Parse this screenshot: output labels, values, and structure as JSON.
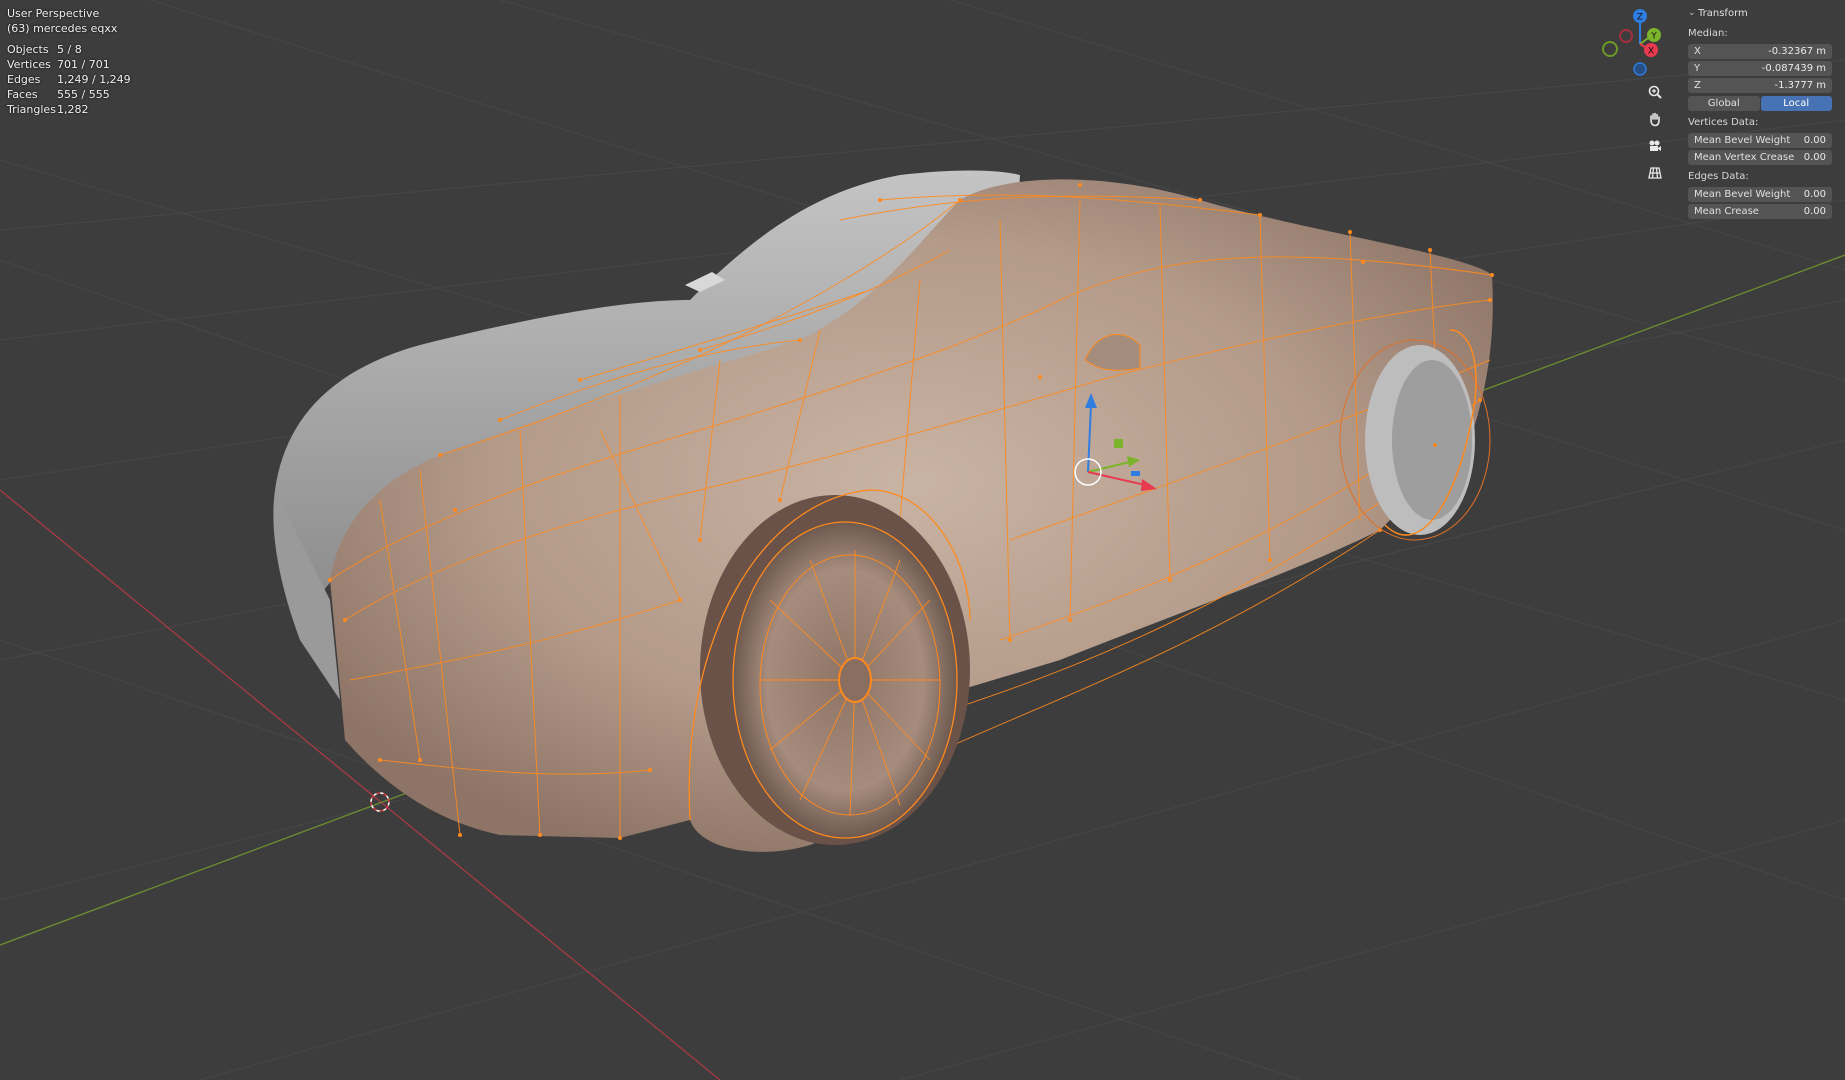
{
  "viewport": {
    "view_name": "User Perspective",
    "object_name": "(63) mercedes eqxx",
    "stats": [
      {
        "label": "Objects",
        "value": "5 / 8"
      },
      {
        "label": "Vertices",
        "value": "701 / 701"
      },
      {
        "label": "Edges",
        "value": "1,249 / 1,249"
      },
      {
        "label": "Faces",
        "value": "555 / 555"
      },
      {
        "label": "Triangles",
        "value": "1,282"
      }
    ]
  },
  "gizmo": {
    "axes": {
      "x": "X",
      "y": "Y",
      "z": "Z"
    },
    "colors": {
      "x": "#e8394f",
      "y": "#7bb32a",
      "z": "#2f7de1",
      "selection": "#ff8a1e"
    }
  },
  "tools": [
    "zoom-icon",
    "hand-pan-icon",
    "camera-icon",
    "grid-view-icon"
  ],
  "transform_panel": {
    "title": "Transform",
    "median_label": "Median:",
    "x": {
      "label": "X",
      "value": "-0.32367 m"
    },
    "y": {
      "label": "Y",
      "value": "-0.087439 m"
    },
    "z": {
      "label": "Z",
      "value": "-1.3777 m"
    },
    "space_global": "Global",
    "space_local": "Local",
    "vertices_data_label": "Vertices Data:",
    "vert_bevel": {
      "label": "Mean Bevel Weight",
      "value": "0.00"
    },
    "vert_crease": {
      "label": "Mean Vertex Crease",
      "value": "0.00"
    },
    "edges_data_label": "Edges Data:",
    "edge_bevel": {
      "label": "Mean Bevel Weight",
      "value": "0.00"
    },
    "edge_crease": {
      "label": "Mean Crease",
      "value": "0.00"
    }
  }
}
